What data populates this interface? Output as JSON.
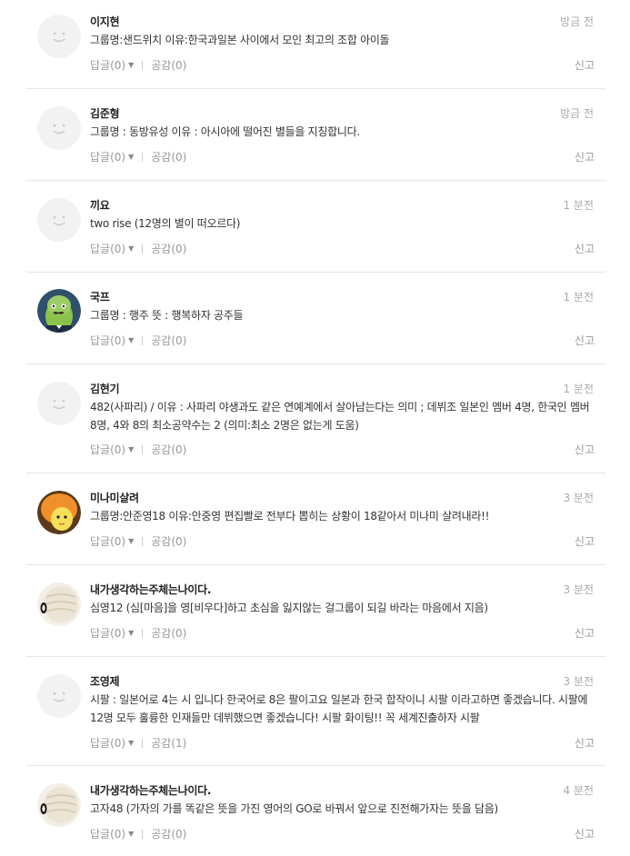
{
  "comments": [
    {
      "author": "이지현",
      "time": "방금 전",
      "text": "그룹명:샌드위치 이유:한국과일본 사이에서 모인 최고의 조합 아이돌",
      "reply": "답글(0)",
      "like": "공감(0)",
      "report": "신고",
      "avatar": "default-icon"
    },
    {
      "author": "김준형",
      "time": "방금 전",
      "text": "그룹명 : 동방유성 이유 : 아시아에 떨어진 별들을 지칭합니다.",
      "reply": "답글(0)",
      "like": "공감(0)",
      "report": "신고",
      "avatar": "default-icon"
    },
    {
      "author": "끼요",
      "time": "1 분전",
      "text": "two rise (12명의 별이 떠오르다)",
      "reply": "답글(0)",
      "like": "공감(0)",
      "report": "신고",
      "avatar": "default-icon"
    },
    {
      "author": "국프",
      "time": "1 분전",
      "text": "그룹명 : 행주 뜻 : 행복하자 공주들",
      "reply": "답글(0)",
      "like": "공감(0)",
      "report": "신고",
      "avatar": "green-character-icon"
    },
    {
      "author": "김현기",
      "time": "1 분전",
      "text": "482(사파리) / 이유 : 사파리 야생과도 같은 연예계에서 살아남는다는 의미 ; 데뷔조 일본인 멤버 4명, 한국인 멤버8명, 4와 8의 최소공약수는 2 (의미:최소 2명은 없는게 도움)",
      "reply": "답글(0)",
      "like": "공감(0)",
      "report": "신고",
      "avatar": "default-icon"
    },
    {
      "author": "미나미살려",
      "time": "3 분전",
      "text": "그룹명:안준영18 이유:안중영 편집빨로 전부다 뽑히는 상황이 18같아서 미나미 살려내라!!",
      "reply": "답글(0)",
      "like": "공감(0)",
      "report": "신고",
      "avatar": "orange-hair-character-icon"
    },
    {
      "author": "내가생각하는주체는나이다.",
      "time": "3 분전",
      "text": "심영12 (심[마음]을 영[비우다]하고 초심을 잃지않는 걸그룹이 되길 바라는 마음에서 지음)",
      "reply": "답글(0)",
      "like": "공감(0)",
      "report": "신고",
      "avatar": "white-character-icon"
    },
    {
      "author": "조영제",
      "time": "3 분전",
      "text": "시팔 : 일본어로 4는 시 입니다 한국어로 8은 팔이고요 일본과 한국 합작이니 시팔 이라고하면 좋겠습니다. 시팔에 12명 모두 훌륭한 인재들만 데뷔했으면 좋겠습니다! 시팔 화이팅!! 꼭 세계진출하자 시팔",
      "reply": "답글(0)",
      "like": "공감(1)",
      "report": "신고",
      "avatar": "default-icon"
    },
    {
      "author": "내가생각하는주체는나이다.",
      "time": "4 분전",
      "text": "고자48 (가자의 가를 똑같은 뜻을 가진 영어의 GO로 바꿔서 앞으로 진전해가자는 뜻을 담음)",
      "reply": "답글(0)",
      "like": "공감(0)",
      "report": "신고",
      "avatar": "white-character-icon"
    }
  ]
}
